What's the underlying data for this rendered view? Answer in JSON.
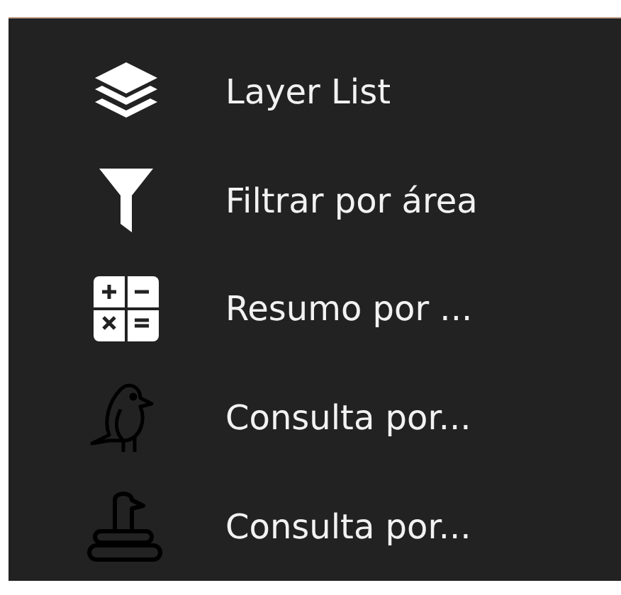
{
  "menu": {
    "items": [
      {
        "label": "Layer List"
      },
      {
        "label": "Filtrar por área"
      },
      {
        "label": "Resumo por ..."
      },
      {
        "label": "Consulta por..."
      },
      {
        "label": "Consulta por..."
      }
    ]
  }
}
